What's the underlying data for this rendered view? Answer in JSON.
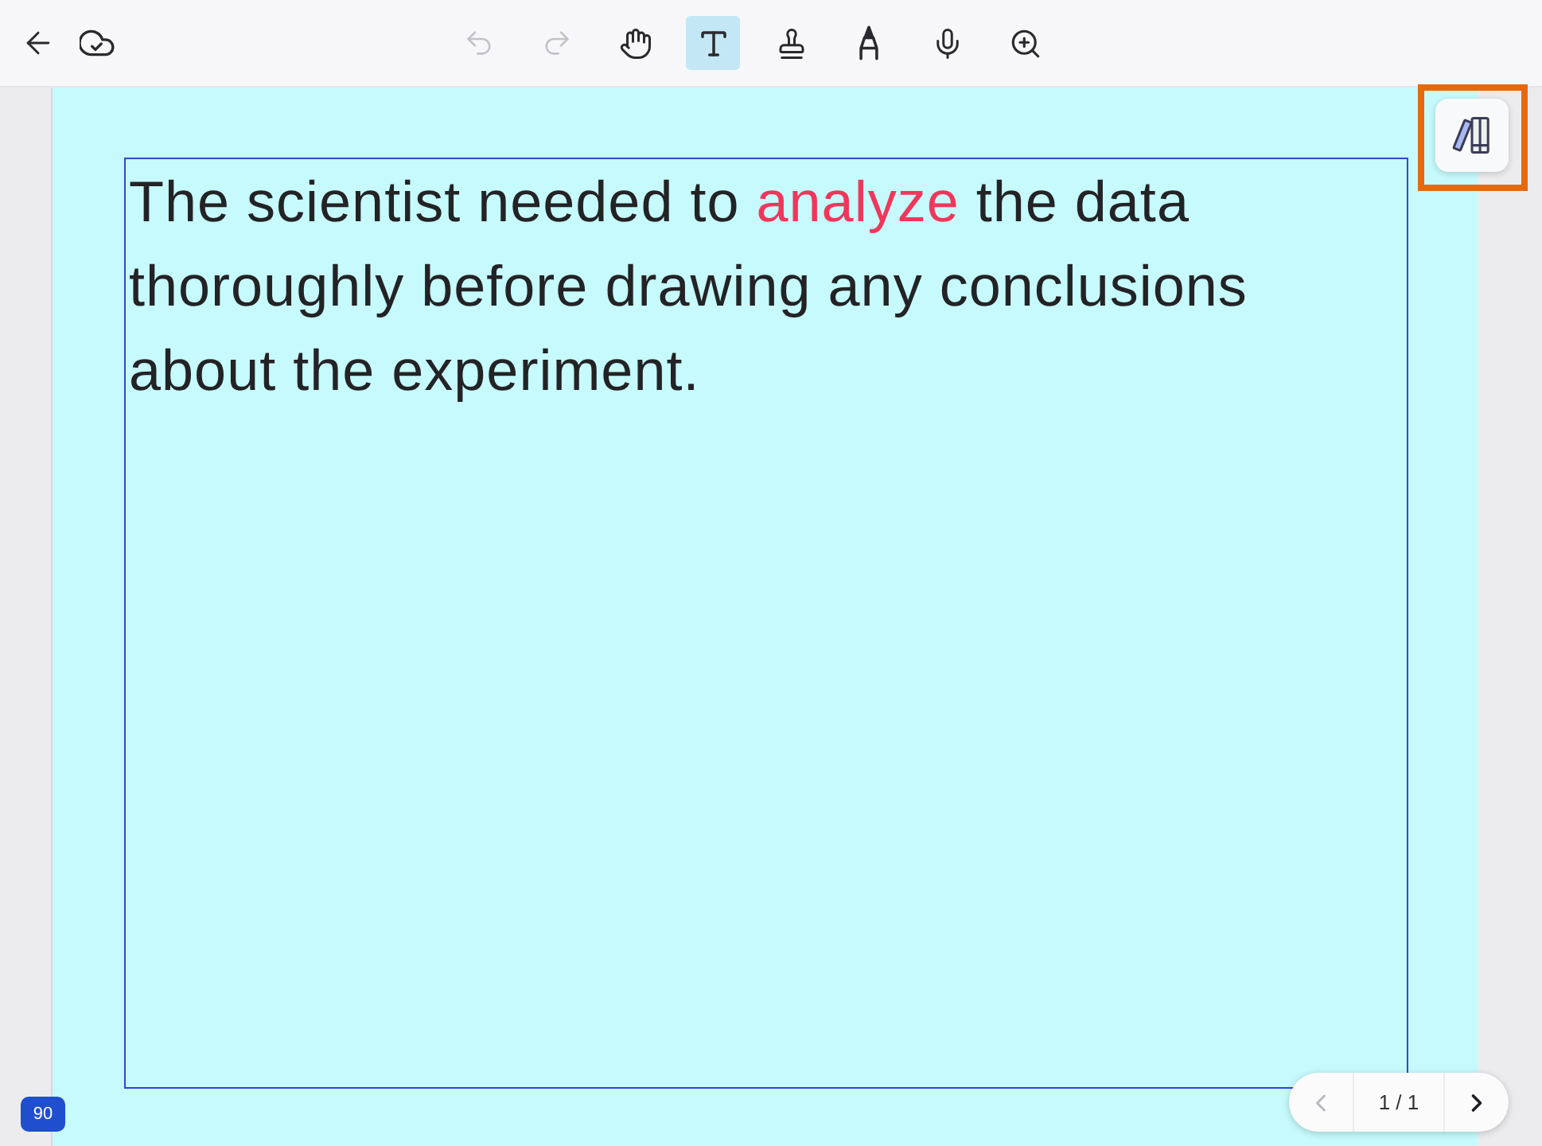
{
  "toolbar": {
    "history": [
      {
        "kind": "undo",
        "disabled": true
      },
      {
        "kind": "redo",
        "disabled": true
      }
    ],
    "tools": [
      {
        "kind": "hand",
        "selected": false
      },
      {
        "kind": "text",
        "selected": true
      },
      {
        "kind": "stamp",
        "selected": false
      },
      {
        "kind": "marker",
        "selected": false
      },
      {
        "kind": "microphone",
        "selected": false
      },
      {
        "kind": "zoom",
        "selected": false
      }
    ]
  },
  "document": {
    "text_box": {
      "segments": [
        {
          "text": "The scientist needed to ",
          "highlighted": false
        },
        {
          "text": "analyze",
          "highlighted": true
        },
        {
          "text": " the data thoroughly before drawing any conclusions about the experiment.",
          "highlighted": false
        }
      ]
    }
  },
  "library_button": {
    "highlighted": true
  },
  "zoom_badge": {
    "label": "90"
  },
  "pager": {
    "label": "1 / 1",
    "previous": {
      "disabled": true
    },
    "next": {
      "disabled": false
    }
  }
}
